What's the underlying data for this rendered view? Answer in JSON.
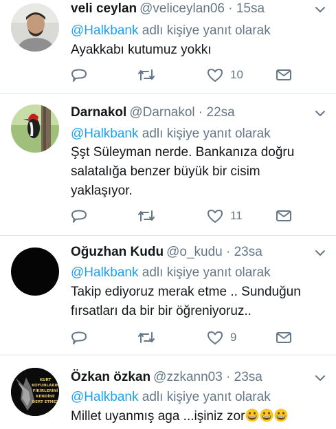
{
  "tweets": [
    {
      "name": "veli ceylan",
      "handle": "@veliceylan06 · 15sa",
      "reply_prefix": "@Halkbank",
      "reply_suffix": " adlı kişiye yanıt olarak",
      "text": "Ayakkabı kutumuz yokkı",
      "likes": "10"
    },
    {
      "name": "Darnakol",
      "handle": "@Darnakol · 22sa",
      "reply_prefix": "@Halkbank",
      "reply_suffix": " adlı kişiye yanıt olarak",
      "text": "Şşt Süleyman nerde. Bankanıza doğru salatalığa benzer büyük bir cisim yaklaşıyor.",
      "likes": "11"
    },
    {
      "name": "Oğuzhan Kudu",
      "handle": "@o_kudu · 23sa",
      "reply_prefix": "@Halkbank",
      "reply_suffix": " adlı kişiye yanıt olarak",
      "text": "Takip ediyoruz merak etme .. Sunduğun fırsatları da bir bir öğreniyoruz..",
      "likes": "9"
    },
    {
      "name": "Özkan özkan",
      "handle": "@zzkann03 · 23sa",
      "reply_prefix": "@Halkbank",
      "reply_suffix": " adlı kişiye yanıt olarak",
      "text": "Millet uyanmış aga ...işiniz zor",
      "avatar_text": [
        "KURT",
        "KOYUNLARIN",
        "FİKİRLERİNİ",
        "KENDİNE",
        "DERT ETMEZ"
      ]
    }
  ],
  "colors": {
    "name": "#14171a",
    "secondary": "#657786",
    "link": "#1da1f2",
    "divider": "#e1e8ed",
    "icon": "#657786"
  },
  "icons": [
    "reply-icon",
    "retweet-icon",
    "like-icon",
    "message-icon",
    "chevron-down-icon",
    "grinning-emoji"
  ]
}
